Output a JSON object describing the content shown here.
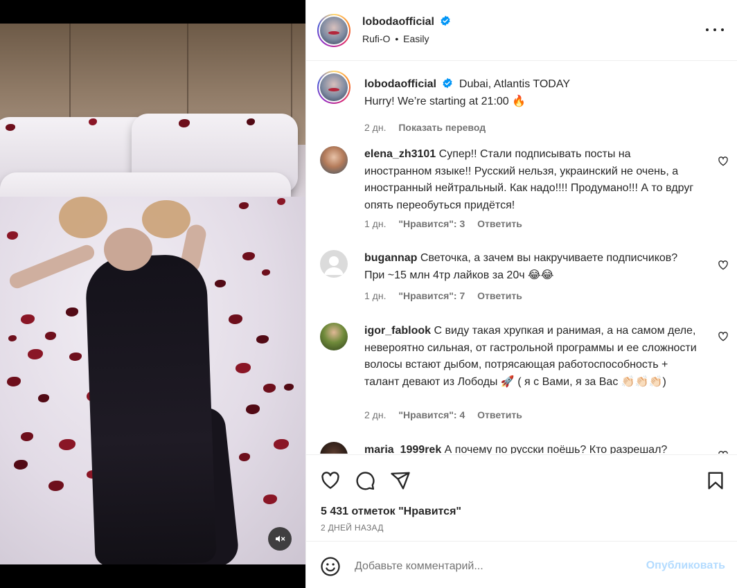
{
  "post": {
    "author": "lobodaofficial",
    "audio_artist": "Rufi-O",
    "audio_separator": "•",
    "audio_track": "Easily"
  },
  "caption": {
    "username": "lobodaofficial",
    "location": "Dubai, Atlantis TODAY",
    "text": "Hurry! We’re starting at 21:00 🔥",
    "age": "2 дн.",
    "translate": "Показать перевод"
  },
  "comments": [
    {
      "username": "elena_zh3101",
      "text": "Супер!! Стали подписывать посты на иностранном языке!! Русский нельзя, украинский не очень, а иностранный нейтральный. Как надо!!!! Продумано!!! А то вдруг опять переобуться придётся!",
      "age": "1 дн.",
      "likes": "\"Нравится\": 3",
      "reply": "Ответить"
    },
    {
      "username": "bugannap",
      "text": "Светочка, а зачем вы накручиваете подписчиков? При ~15 млн 4тр лайков за 20ч 😂😂",
      "age": "1 дн.",
      "likes": "\"Нравится\": 7",
      "reply": "Ответить"
    },
    {
      "username": "igor_fablook",
      "text": "С виду такая хрупкая и ранимая, а на самом деле, невероятно сильная, от гастрольной программы и ее сложности волосы встают дыбом, потрясающая работоспособность + талант девают из Лободы 🚀 ( я с Вами, я за Вас 👏🏻👏🏻👏🏻)",
      "age": "2 дн.",
      "likes": "\"Нравится\": 4",
      "reply": "Ответить"
    },
    {
      "username": "maria_1999rek",
      "text": "А почему по русски поёшь? Кто разрешал?"
    }
  ],
  "stats": {
    "likes": "5 431 отметок \"Нравится\"",
    "date": "2 ДНЕЙ НАЗАД"
  },
  "composer": {
    "placeholder": "Добавьте комментарий...",
    "post_label": "Опубликовать"
  },
  "icons": {
    "verified": "verified-badge-icon",
    "more": "more-options-icon",
    "like": "heart-icon",
    "comment": "comment-bubble-icon",
    "share": "paper-plane-icon",
    "save": "bookmark-icon",
    "emoji": "smiley-icon",
    "mute": "speaker-muted-icon"
  },
  "colors": {
    "accent": "#0095f6",
    "verified": "#0095f6",
    "post_disabled": "#b3dbff",
    "secondary_text": "#737373"
  }
}
